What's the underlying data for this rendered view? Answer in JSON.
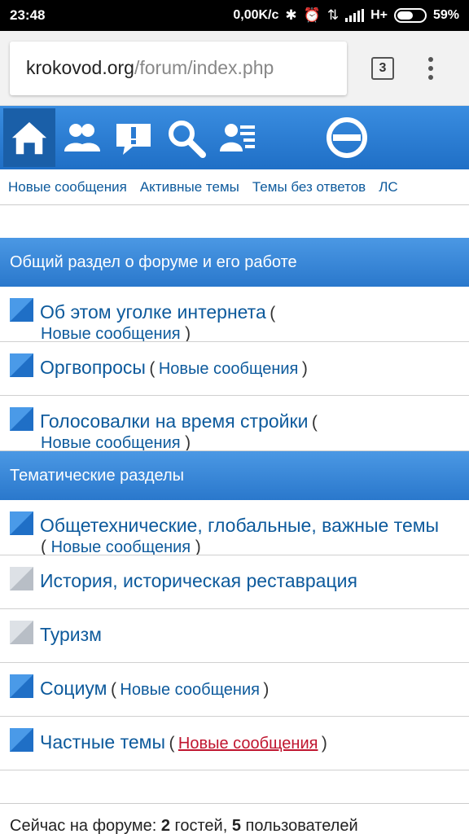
{
  "status": {
    "time": "23:48",
    "speed": "0,00K/c",
    "network": "H+",
    "battery_text": "59%",
    "battery_level": 0.59
  },
  "browser": {
    "url_host": "krokovod.org",
    "url_path": "/forum/index.php",
    "tab_count": "3"
  },
  "toolbar": {
    "icons": [
      "home-icon",
      "users-icon",
      "alert-icon",
      "search-icon",
      "members-icon",
      "logout-icon"
    ]
  },
  "nav": {
    "links": [
      "Новые сообщения",
      "Активные темы",
      "Темы без ответов",
      "ЛС"
    ]
  },
  "sections": [
    {
      "title": "Общий раздел о форуме и его работе",
      "forums": [
        {
          "name": "Об этом уголке интернета",
          "new_label": "Новые сообщения",
          "status": "new"
        },
        {
          "name": "Оргвопросы",
          "new_label": "Новые сообщения",
          "status": "new"
        },
        {
          "name": "Голосовалки на время стройки",
          "new_label": "Новые сообщения",
          "status": "new"
        }
      ]
    },
    {
      "title": "Тематические разделы",
      "forums": [
        {
          "name": "Общетехнические, глобальные, важные темы",
          "new_label": "Новые сообщения",
          "status": "new"
        },
        {
          "name": "История, историческая реставрация",
          "new_label": "",
          "status": "read"
        },
        {
          "name": "Туризм",
          "new_label": "",
          "status": "read"
        },
        {
          "name": "Социум",
          "new_label": "Новые сообщения",
          "status": "new"
        },
        {
          "name": "Частные темы",
          "new_label": "Новые сообщения",
          "status": "new"
        }
      ]
    }
  ],
  "online": {
    "prefix": "Сейчас на форуме:",
    "guests": "2",
    "guests_label": "гостей,",
    "users": "5",
    "users_label": "пользователей"
  },
  "colors": {
    "toolbar_blue": "#2a7bd2",
    "link_blue": "#0d5a9c",
    "visited_red": "#c0152f"
  }
}
